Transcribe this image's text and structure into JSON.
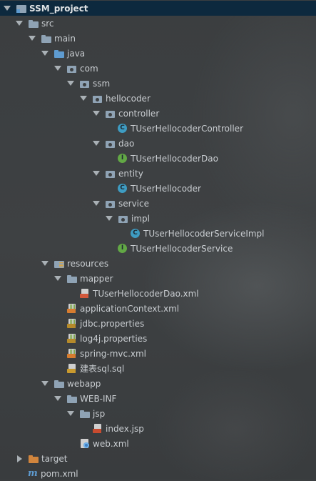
{
  "project_tree": {
    "root": "SSM_project",
    "src": "src",
    "main": "main",
    "java": "java",
    "com": "com",
    "ssm": "ssm",
    "hellocoder": "hellocoder",
    "controller": "controller",
    "controller_class": "TUserHellocoderController",
    "dao": "dao",
    "dao_interface": "TUserHellocoderDao",
    "entity": "entity",
    "entity_class": "TUserHellocoder",
    "service": "service",
    "impl": "impl",
    "impl_class": "TUserHellocoderServiceImpl",
    "service_interface": "TUserHellocoderService",
    "resources": "resources",
    "mapper": "mapper",
    "mapper_xml": "TUserHellocoderDao.xml",
    "application_context": "applicationContext.xml",
    "jdbc_properties": "jdbc.properties",
    "log4j_properties": "log4j.properties",
    "spring_mvc": "spring-mvc.xml",
    "sql_file": "建表sql.sql",
    "webapp": "webapp",
    "web_inf": "WEB-INF",
    "jsp": "jsp",
    "index_jsp": "index.jsp",
    "web_xml": "web.xml",
    "target": "target",
    "pom": "pom.xml"
  },
  "icon_letters": {
    "class": "C",
    "interface": "I"
  },
  "colors": {
    "background": "#3c3f41",
    "selected_row": "#0d293e",
    "text": "#c9cdd1",
    "class_icon": "#3e9cc2",
    "interface_icon": "#62a845",
    "folder_blue": "#5e9bd0",
    "folder_orange": "#d1853d"
  }
}
